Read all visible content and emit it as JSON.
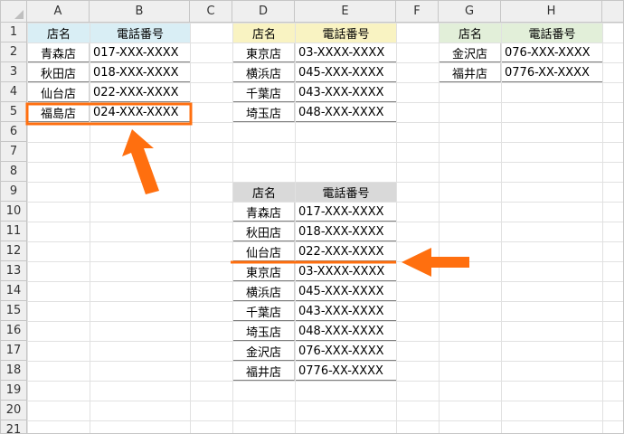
{
  "columns": [
    "A",
    "B",
    "C",
    "D",
    "E",
    "F",
    "G",
    "H"
  ],
  "rows": [
    "1",
    "2",
    "3",
    "4",
    "5",
    "6",
    "7",
    "8",
    "9",
    "10",
    "11",
    "12",
    "13",
    "14",
    "15",
    "16",
    "17",
    "18",
    "19",
    "20",
    "21"
  ],
  "colors": {
    "header_blue": "#d9eef5",
    "header_yellow": "#f9f3c2",
    "header_green": "#e2efd9",
    "header_gray": "#d9d9d9",
    "highlight_orange": "#ff6f0f"
  },
  "table_a": {
    "header": [
      "店名",
      "電話番号"
    ],
    "rows": [
      [
        "青森店",
        "017-XXX-XXXX"
      ],
      [
        "秋田店",
        "018-XXX-XXXX"
      ],
      [
        "仙台店",
        "022-XXX-XXXX"
      ],
      [
        "福島店",
        "024-XXX-XXXX"
      ]
    ]
  },
  "table_d": {
    "header": [
      "店名",
      "電話番号"
    ],
    "rows": [
      [
        "東京店",
        "03-XXXX-XXXX"
      ],
      [
        "横浜店",
        "045-XXX-XXXX"
      ],
      [
        "千葉店",
        "043-XXX-XXXX"
      ],
      [
        "埼玉店",
        "048-XXX-XXXX"
      ]
    ]
  },
  "table_g": {
    "header": [
      "店名",
      "電話番号"
    ],
    "rows": [
      [
        "金沢店",
        "076-XXX-XXXX"
      ],
      [
        "福井店",
        "0776-XX-XXXX"
      ]
    ]
  },
  "table_merged": {
    "header": [
      "店名",
      "電話番号"
    ],
    "rows": [
      [
        "青森店",
        "017-XXX-XXXX"
      ],
      [
        "秋田店",
        "018-XXX-XXXX"
      ],
      [
        "仙台店",
        "022-XXX-XXXX"
      ],
      [
        "東京店",
        "03-XXXX-XXXX"
      ],
      [
        "横浜店",
        "045-XXX-XXXX"
      ],
      [
        "千葉店",
        "043-XXX-XXXX"
      ],
      [
        "埼玉店",
        "048-XXX-XXXX"
      ],
      [
        "金沢店",
        "076-XXX-XXXX"
      ],
      [
        "福井店",
        "0776-XX-XXXX"
      ]
    ]
  }
}
